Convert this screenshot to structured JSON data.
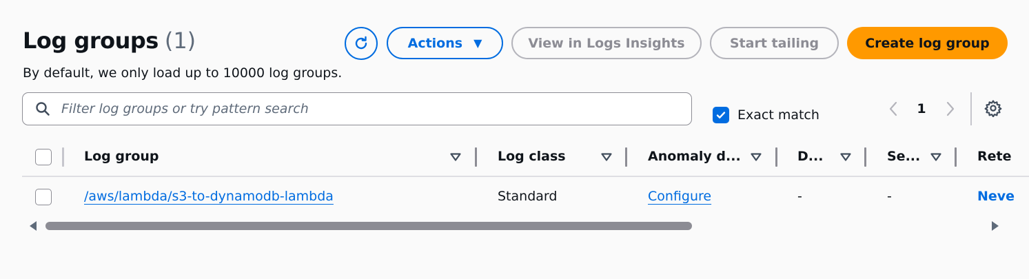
{
  "header": {
    "title": "Log groups",
    "count": "(1)",
    "subtitle": "By default, we only load up to 10000 log groups."
  },
  "toolbar": {
    "refresh_icon": "refresh-icon",
    "actions_label": "Actions",
    "logs_insights_label": "View in Logs Insights",
    "start_tailing_label": "Start tailing",
    "create_label": "Create log group"
  },
  "filter": {
    "placeholder": "Filter log groups or try pattern search",
    "value": "",
    "exact_match_label": "Exact match",
    "exact_match_checked": true
  },
  "pagination": {
    "current_page": "1"
  },
  "table": {
    "columns": [
      {
        "label": "Log group"
      },
      {
        "label": "Log class"
      },
      {
        "label": "Anomaly d..."
      },
      {
        "label": "D..."
      },
      {
        "label": "Se..."
      },
      {
        "label": "Rete"
      }
    ],
    "rows": [
      {
        "log_group": "/aws/lambda/s3-to-dynamodb-lambda",
        "log_class": "Standard",
        "anomaly_detection": "Configure",
        "data_protection": "-",
        "sensitive_data": "-",
        "retention": "Neve"
      }
    ]
  },
  "colors": {
    "primary": "#006ce0",
    "create_button": "#ff9900",
    "disabled": "#8c8c94"
  }
}
